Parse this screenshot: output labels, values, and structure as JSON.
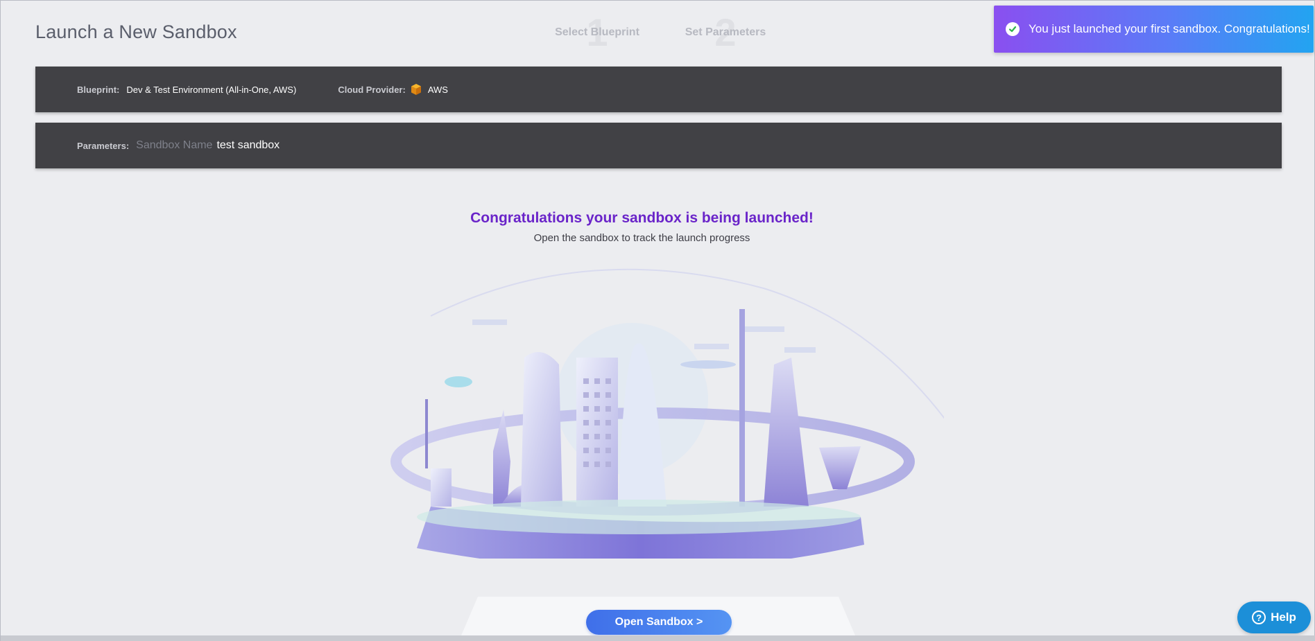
{
  "page": {
    "title": "Launch a New Sandbox"
  },
  "stepper": {
    "steps": [
      {
        "number": "1",
        "label": "Select Blueprint"
      },
      {
        "number": "2",
        "label": "Set Parameters"
      }
    ]
  },
  "toast": {
    "icon": "check-circle-icon",
    "message": "You just launched your first sandbox. Congratulations!",
    "colors": [
      "#8a4ff0",
      "#22a4f1"
    ]
  },
  "summary": {
    "blueprint_label": "Blueprint:",
    "blueprint_value": "Dev & Test Environment (All-in-One, AWS)",
    "cloud_label": "Cloud Provider:",
    "cloud_icon": "aws-cube-icon",
    "cloud_value": "AWS"
  },
  "parameters": {
    "label": "Parameters:",
    "field_label": "Sandbox Name",
    "field_value": "test sandbox"
  },
  "result": {
    "headline": "Congratulations your sandbox is being launched!",
    "subline": "Open the sandbox to track the launch progress",
    "accent": "#6a24c9"
  },
  "actions": {
    "open_sandbox": "Open Sandbox >",
    "help": "Help",
    "help_icon": "question-circle-icon"
  }
}
